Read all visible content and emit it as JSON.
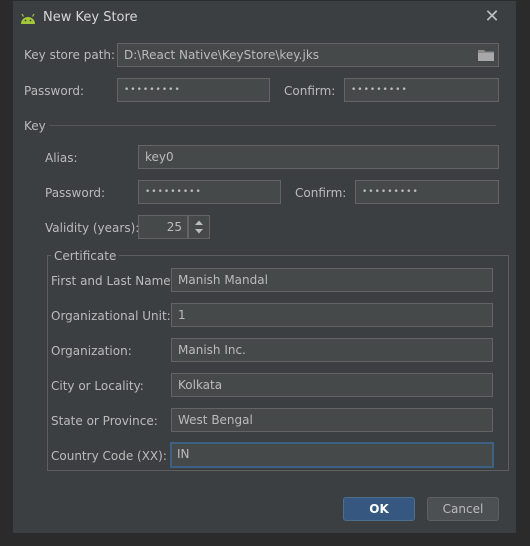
{
  "window": {
    "title": "New Key Store",
    "close_symbol": "✕"
  },
  "keystore": {
    "path_label": "Key store path:",
    "path_value": "D:\\React Native\\KeyStore\\key.jks",
    "password_label": "Password:",
    "password_value": "•••••••••",
    "confirm_label": "Confirm:",
    "confirm_value": "•••••••••"
  },
  "key": {
    "section_label": "Key",
    "alias_label": "Alias:",
    "alias_value": "key0",
    "password_label": "Password:",
    "password_value": "•••••••••",
    "confirm_label": "Confirm:",
    "confirm_value": "•••••••••",
    "validity_label": "Validity (years):",
    "validity_value": "25"
  },
  "certificate": {
    "title": "Certificate",
    "name_label": "First and Last Name:",
    "name_value": "Manish Mandal",
    "unit_label": "Organizational Unit:",
    "unit_value": "1",
    "org_label": "Organization:",
    "org_value": "Manish Inc.",
    "city_label": "City or Locality:",
    "city_value": "Kolkata",
    "state_label": "State or Province:",
    "state_value": "West Bengal",
    "country_label": "Country Code (XX):",
    "country_value": "IN"
  },
  "buttons": {
    "ok": "OK",
    "cancel": "Cancel"
  },
  "colors": {
    "android_green": "#a4c639",
    "ok_blue": "#365880",
    "focus_border": "#3d6185"
  }
}
